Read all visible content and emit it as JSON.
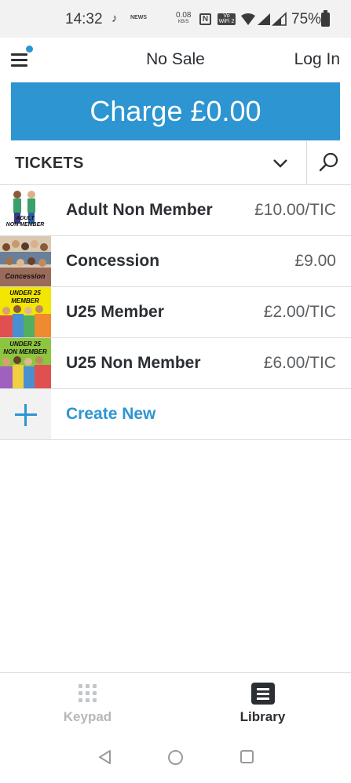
{
  "status_bar": {
    "time": "14:32",
    "tiktok_glyph": "♪",
    "news_label": "NEWS",
    "speed_value": "0.08",
    "speed_unit": "KB/S",
    "nfc_label": "N",
    "wifi_badge": "Vo WiFi 2",
    "battery_percent": "75%"
  },
  "header": {
    "title": "No Sale",
    "login_label": "Log In"
  },
  "charge": {
    "label": "Charge £0.00"
  },
  "category": {
    "label": "TICKETS"
  },
  "items": [
    {
      "name": "Adult Non Member",
      "price": "£10.00/TIC",
      "thumb_caption": "ADULT NON MEMBER",
      "thumb_bg": "#ffffff"
    },
    {
      "name": "Concession",
      "price": "£9.00",
      "thumb_caption": "Concession",
      "thumb_bg": "#d9c9b2"
    },
    {
      "name": "U25 Member",
      "price": "£2.00/TIC",
      "thumb_caption": "UNDER 25 MEMBER",
      "thumb_bg": "#f3e600"
    },
    {
      "name": "U25 Non Member",
      "price": "£6.00/TIC",
      "thumb_caption": "UNDER 25 NON MEMBER",
      "thumb_bg": "#8cc63f"
    }
  ],
  "create_new": {
    "label": "Create New"
  },
  "tabs": {
    "keypad_label": "Keypad",
    "library_label": "Library"
  },
  "colors": {
    "accent": "#2d95d1",
    "text": "#2b2f33",
    "muted": "#5b5f63"
  }
}
